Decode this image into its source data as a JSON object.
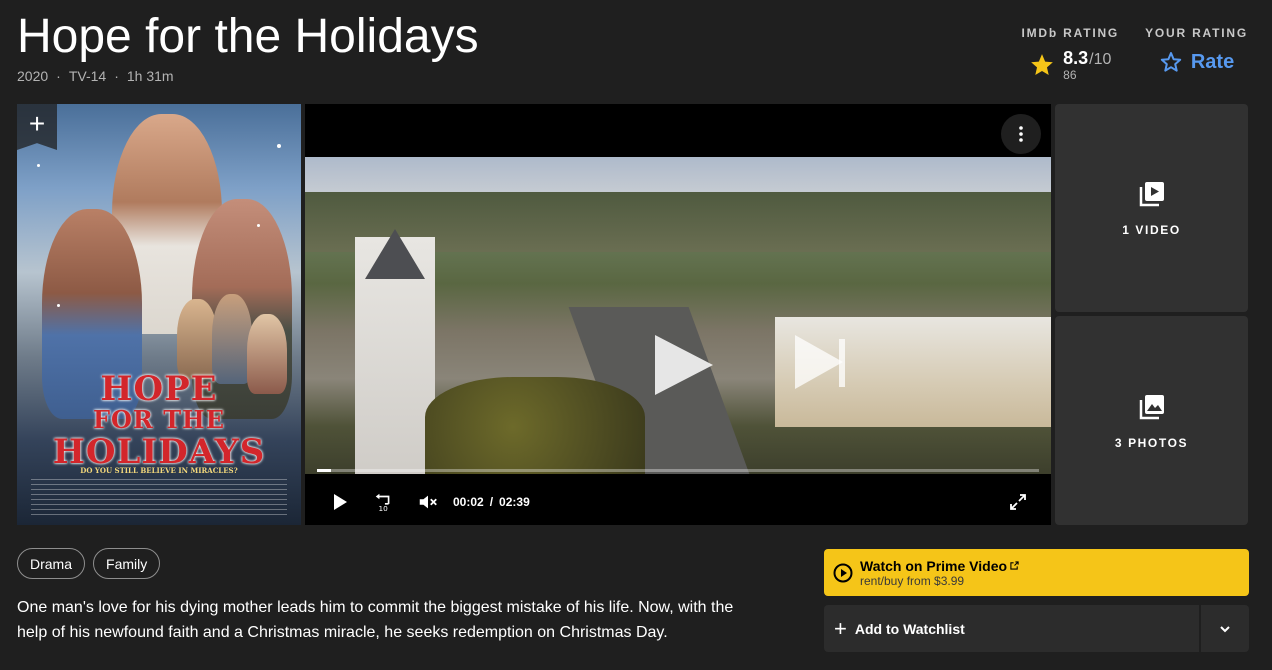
{
  "header": {
    "title": "Hope for the Holidays",
    "year": "2020",
    "certificate": "TV-14",
    "runtime": "1h 31m",
    "separator": "·"
  },
  "ratings": {
    "imdb_label": "IMDb RATING",
    "score": "8.3",
    "score_max": "/10",
    "votes": "86",
    "your_label": "YOUR RATING",
    "rate_label": "Rate",
    "star_color": "#f5c518",
    "rate_color": "#5799ef"
  },
  "poster": {
    "add_label": "+",
    "title_line1": "HOPE",
    "title_line2": "FOR THE",
    "title_line3": "HOLIDAYS",
    "tagline": "DO YOU STILL BELIEVE IN MIRACLES?"
  },
  "video": {
    "current_time": "00:02",
    "divider": "/",
    "duration": "02:39",
    "progress_fraction": 0.0126,
    "menu_icon": "kebab-icon"
  },
  "tiles": {
    "videos_label": "1 VIDEO",
    "photos_label": "3 PHOTOS"
  },
  "genres": [
    "Drama",
    "Family"
  ],
  "plot": "One man's love for his dying mother leads him to commit the biggest mistake of his life. Now, with the help of his newfound faith and a Christmas miracle, he seeks redemption on Christmas Day.",
  "watch": {
    "prime_title": "Watch on Prime Video",
    "prime_sub": "rent/buy from $3.99",
    "prime_color": "#f5c518",
    "watchlist_label": "Add to Watchlist",
    "plus": "+"
  }
}
